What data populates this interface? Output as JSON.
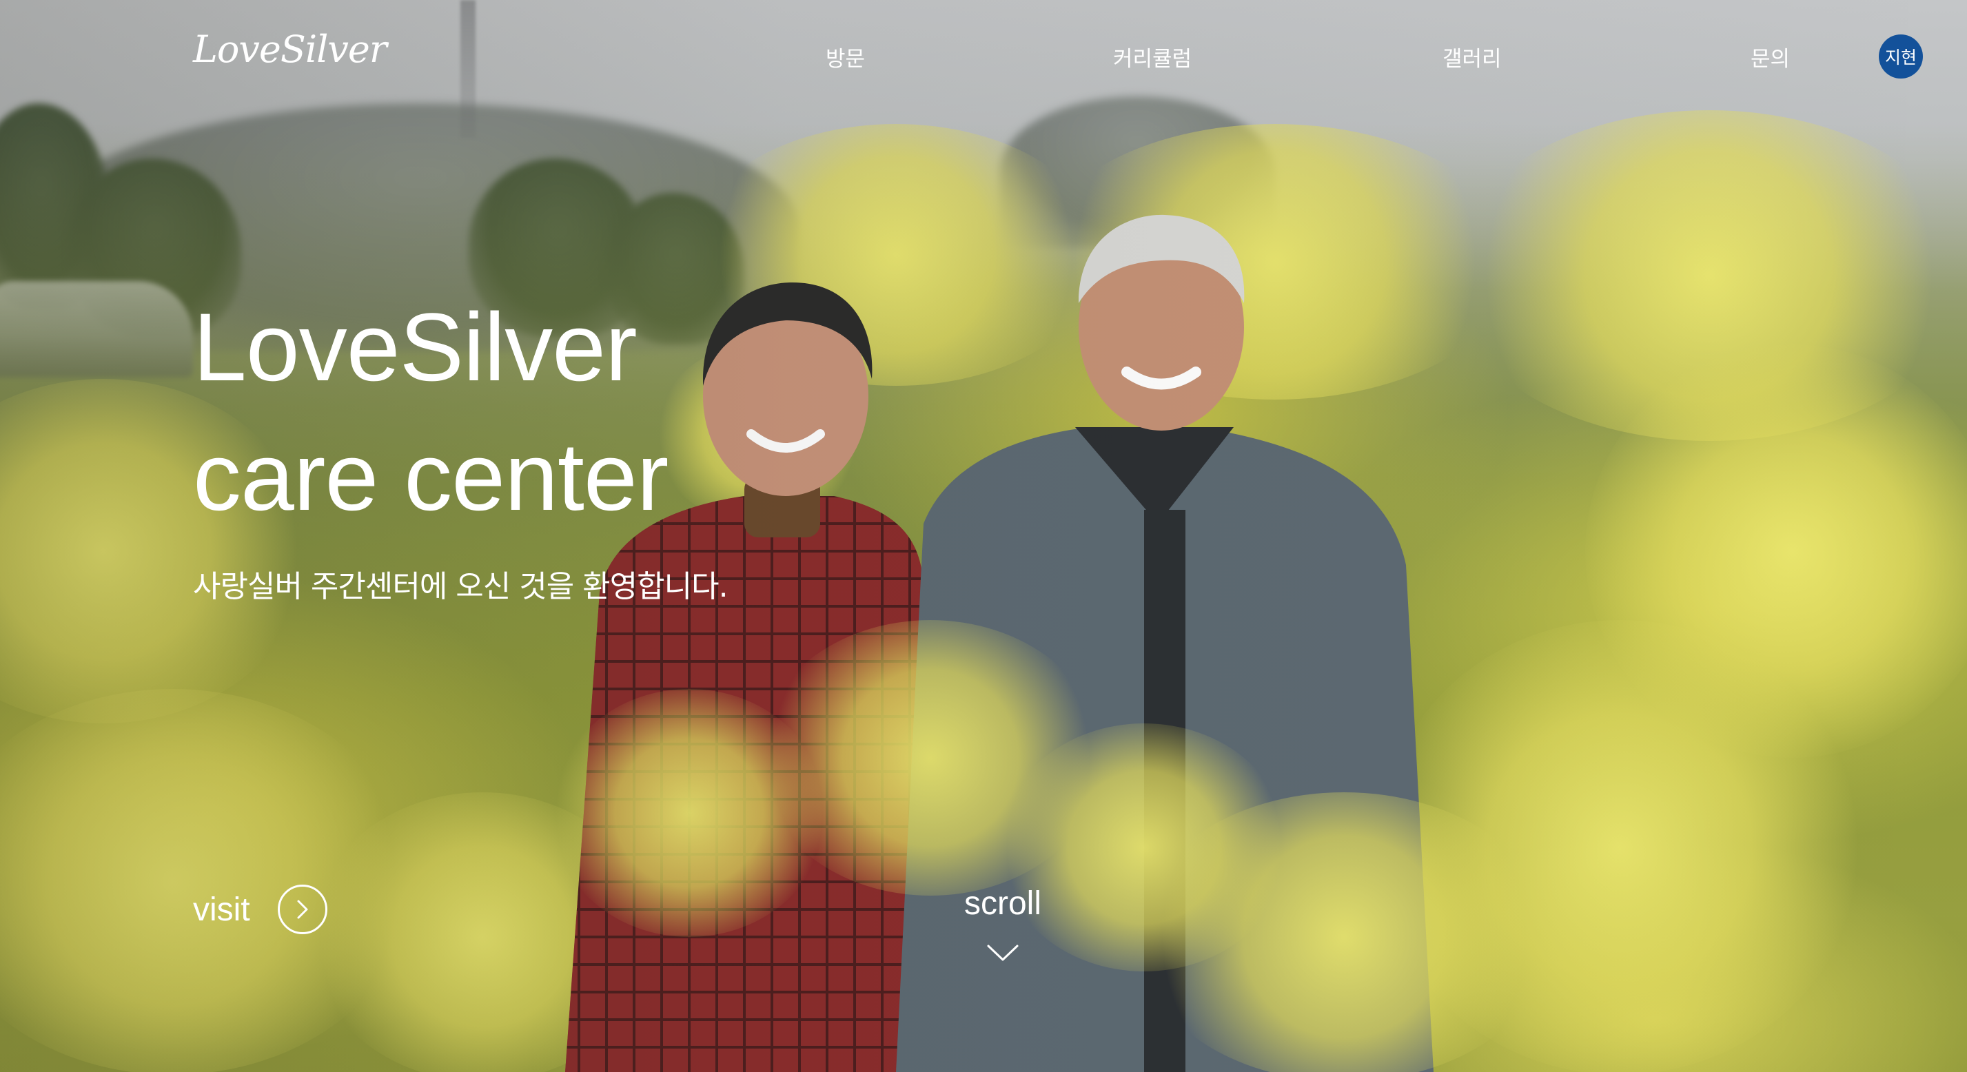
{
  "header": {
    "logo": "LoveSilver",
    "nav": [
      "방문",
      "커리큘럼",
      "갤러리",
      "문의"
    ],
    "user_avatar": "지현",
    "avatar_color": "#13519a"
  },
  "hero": {
    "title_line1": "LoveSilver",
    "title_line2": "care center",
    "subtitle": "사랑실버 주간센터에 오신 것을 환영합니다.",
    "visit_label": "visit",
    "visit_icon": "chevron-right-circle-icon",
    "scroll_label": "scroll",
    "scroll_icon": "chevron-down-icon",
    "background_image": "elderly couple smiling in a rapeseed flower field"
  }
}
